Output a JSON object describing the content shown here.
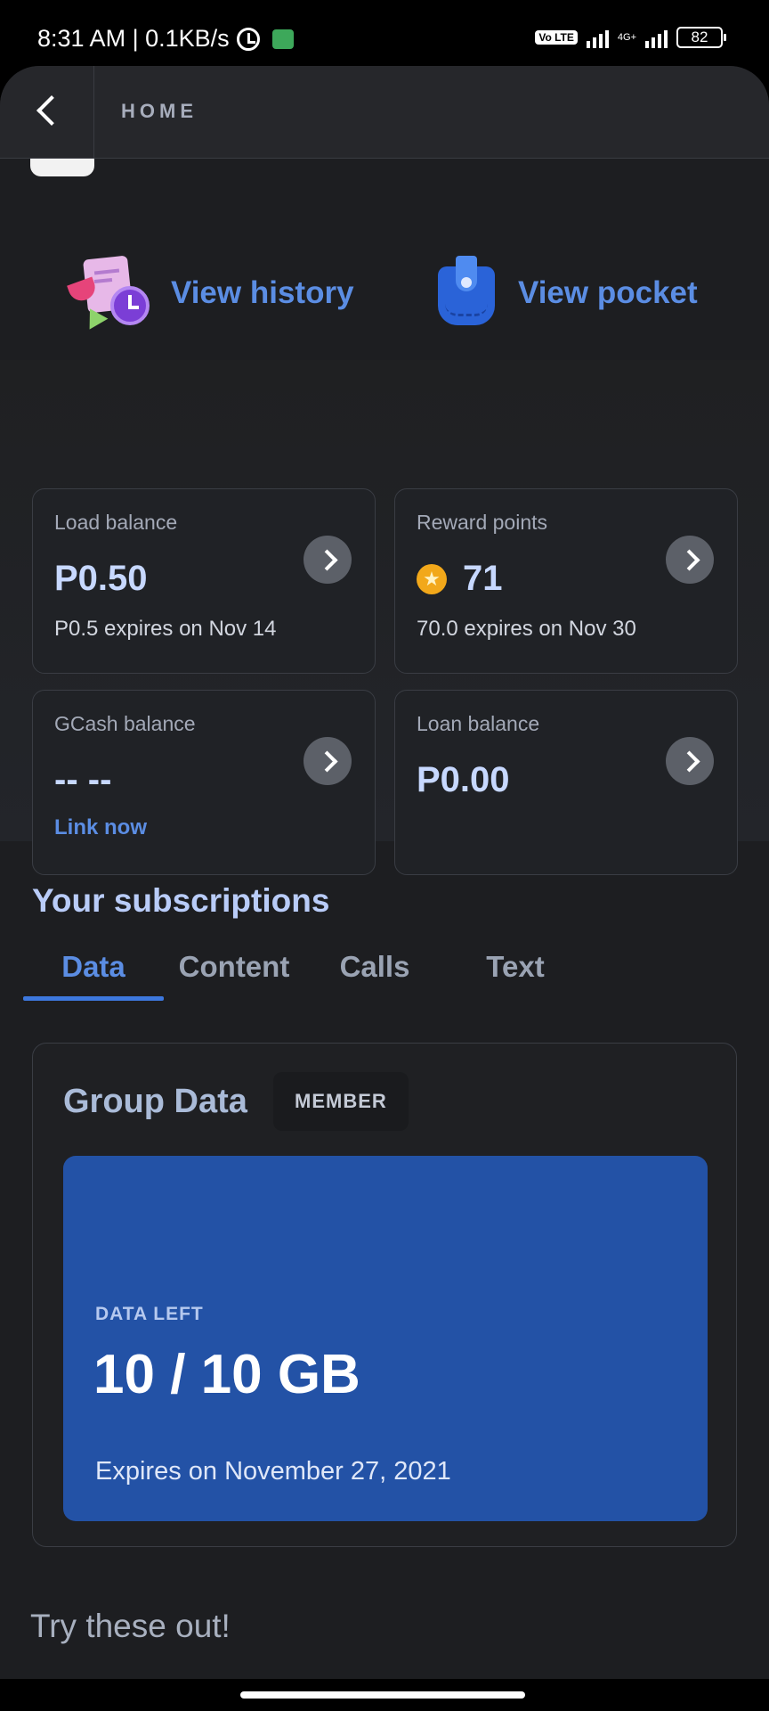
{
  "status_bar": {
    "time": "8:31 AM | 0.1KB/s",
    "network": "4G+",
    "battery": "82",
    "volte": "Vo LTE"
  },
  "header": {
    "title": "HOME"
  },
  "quick_actions": {
    "history": {
      "label": "View history",
      "icon": "history-icon"
    },
    "pocket": {
      "label": "View pocket",
      "icon": "pocket-icon"
    }
  },
  "cards": {
    "load": {
      "label": "Load balance",
      "value": "P0.50",
      "sub": "P0.5 expires on Nov 14"
    },
    "rewards": {
      "label": "Reward points",
      "value": "71",
      "sub": "70.0 expires on Nov 30"
    },
    "gcash": {
      "label": "GCash balance",
      "value": "-- --",
      "link": "Link now"
    },
    "loan": {
      "label": "Loan balance",
      "value": "P0.00"
    }
  },
  "subscriptions": {
    "title": "Your subscriptions",
    "tabs": [
      "Data",
      "Content",
      "Calls",
      "Text"
    ],
    "active_tab": "Data",
    "group": {
      "title": "Group Data",
      "badge": "MEMBER",
      "data_left_label": "DATA LEFT",
      "amount": "10 / 10 GB",
      "expiry": "Expires on November 27, 2021"
    }
  },
  "try_title": "Try these out!",
  "colors": {
    "accent": "#5b8de3",
    "background": "#1d1e21",
    "data_panel": "#2352a6",
    "reward_star": "#f2a81a"
  }
}
